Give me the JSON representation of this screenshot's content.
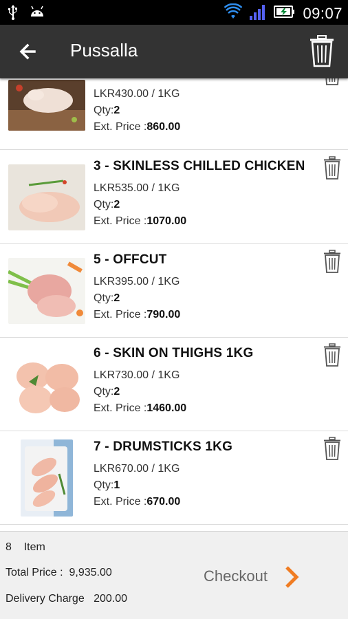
{
  "status_bar": {
    "time": "09:07"
  },
  "app_bar": {
    "title": "Pussalla"
  },
  "items": [
    {
      "name": "",
      "price_line": "LKR430.00   /   1KG",
      "qty_label": "Qty:",
      "qty": "2",
      "ext_label": "Ext. Price :",
      "ext_price": "860.00"
    },
    {
      "name": "3 - SKINLESS CHILLED CHICKEN",
      "price_line": "LKR535.00   /   1KG",
      "qty_label": "Qty:",
      "qty": "2",
      "ext_label": "Ext. Price :",
      "ext_price": "1070.00"
    },
    {
      "name": "5 - OFFCUT",
      "price_line": "LKR395.00   /   1KG",
      "qty_label": "Qty:",
      "qty": "2",
      "ext_label": "Ext. Price :",
      "ext_price": "790.00"
    },
    {
      "name": "6 - SKIN ON THIGHS 1KG",
      "price_line": "LKR730.00   /   1KG",
      "qty_label": "Qty:",
      "qty": "2",
      "ext_label": "Ext. Price :",
      "ext_price": "1460.00"
    },
    {
      "name": "7 - DRUMSTICKS 1KG",
      "price_line": "LKR670.00   /   1KG",
      "qty_label": "Qty:",
      "qty": "1",
      "ext_label": "Ext. Price :",
      "ext_price": "670.00"
    }
  ],
  "footer": {
    "item_count": "8",
    "item_label": "Item",
    "total_label": "Total Price :",
    "total_value": "9,935.00",
    "delivery_label": "Delivery Charge",
    "delivery_value": "200.00",
    "checkout_label": "Checkout"
  },
  "colors": {
    "accent": "#f07c22",
    "app_bar": "#333333",
    "status_bar": "#000000",
    "wifi": "#2f8ff0",
    "signal": "#5561f2"
  },
  "icons": [
    "usb-icon",
    "android-icon",
    "wifi-icon",
    "signal-icon",
    "battery-charging-icon",
    "back-arrow-icon",
    "trash-icon",
    "chevron-right-icon"
  ]
}
